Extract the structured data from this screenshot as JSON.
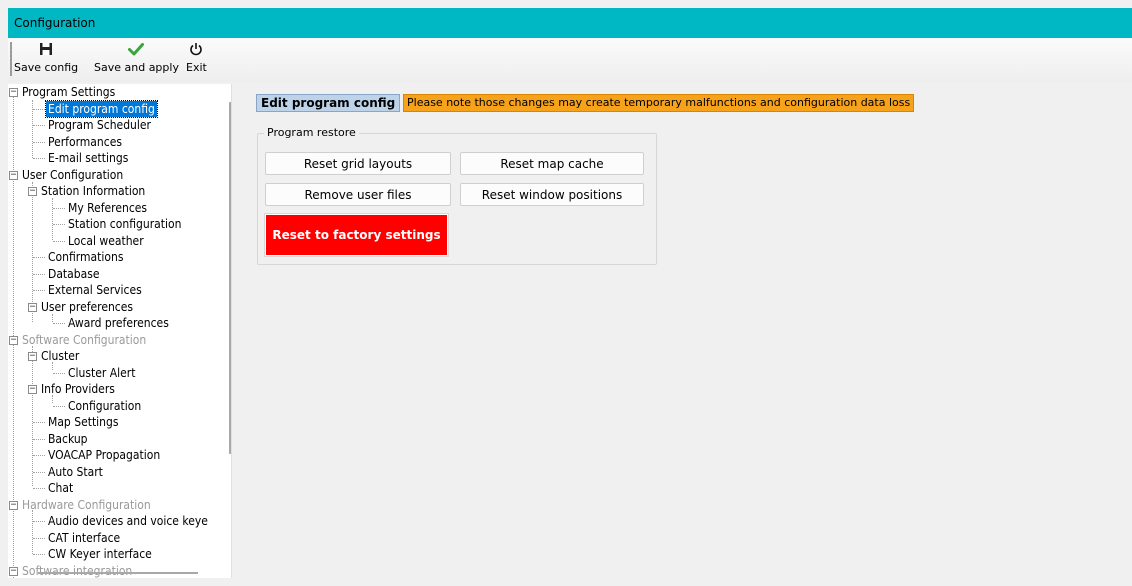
{
  "window": {
    "title": "Configuration"
  },
  "toolbar": {
    "save_config": {
      "label": "Save config",
      "icon": "floppy-disk-icon"
    },
    "save_and_apply": {
      "label": "Save and apply",
      "icon": "checkmark-icon",
      "color": "#3aa63a"
    },
    "exit": {
      "label": "Exit",
      "icon": "power-icon"
    }
  },
  "tree": {
    "program_settings": "Program Settings",
    "edit_program_config": "Edit program config",
    "program_scheduler": "Program Scheduler",
    "performances": "Performances",
    "email_settings": "E-mail settings",
    "user_configuration": "User Configuration",
    "station_information": "Station Information",
    "my_references": "My References",
    "station_configuration": "Station configuration",
    "local_weather": "Local weather",
    "confirmations": "Confirmations",
    "database": "Database",
    "external_services": "External Services",
    "user_preferences": "User preferences",
    "award_preferences": "Award preferences",
    "software_configuration": "Software Configuration",
    "cluster": "Cluster",
    "cluster_alert": "Cluster Alert",
    "info_providers": "Info Providers",
    "configuration": "Configuration",
    "map_settings": "Map Settings",
    "backup": "Backup",
    "voacap_propagation": "VOACAP Propagation",
    "auto_start": "Auto Start",
    "chat": "Chat",
    "hardware_configuration": "Hardware Configuration",
    "audio_devices": "Audio devices and voice keye",
    "cat_interface": "CAT interface",
    "cw_keyer_interface": "CW Keyer interface",
    "software_integration": "Software integration"
  },
  "content": {
    "title": "Edit program config",
    "warning": "Please note those changes may create temporary malfunctions and configuration data loss",
    "group_label": "Program restore",
    "buttons": {
      "reset_grid_layouts": "Reset grid layouts",
      "reset_map_cache": "Reset map cache",
      "remove_user_files": "Remove user files",
      "reset_window_positions": "Reset window positions",
      "reset_factory": "Reset to factory settings"
    }
  },
  "colors": {
    "titlebar": "#00b8c4",
    "selection": "#0078d7",
    "warning_bg": "#f7a21b",
    "danger_button": "#ff0000"
  }
}
